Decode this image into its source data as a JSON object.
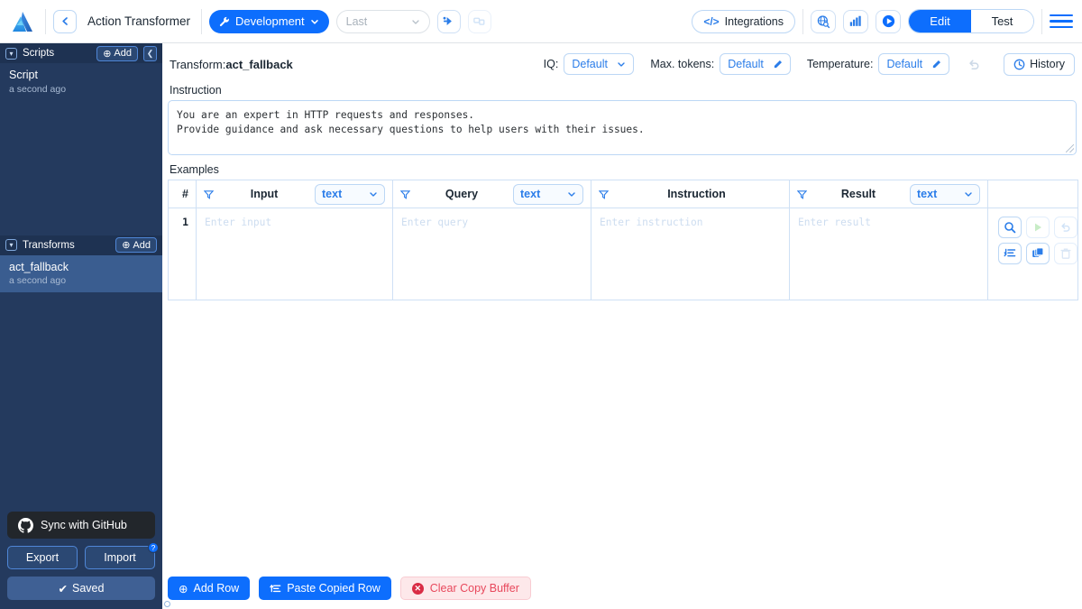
{
  "topbar": {
    "logo_icon": "action-transformer-logo",
    "back_icon": "chevron-left-icon",
    "app_title": "Action Transformer",
    "env_button": {
      "label": "Development",
      "icon": "wrench-icon",
      "caret": "chevron-down-icon"
    },
    "version_select": {
      "placeholder": "Last",
      "caret": "chevron-down-icon"
    },
    "run_icon": "run-arrow-icon",
    "duplicate_icon": "duplicate-icon",
    "integrations_button": {
      "label": "Integrations",
      "icon": "code-brackets-icon"
    },
    "globe_icon": "globe-search-icon",
    "chart_icon": "bar-chart-icon",
    "play_icon": "play-circle-icon",
    "mode_tabs": [
      {
        "label": "Edit",
        "active": true
      },
      {
        "label": "Test",
        "active": false
      }
    ],
    "menu_icon": "hamburger-menu-icon"
  },
  "sidebar": {
    "scripts": {
      "title": "Scripts",
      "add_label": "Add",
      "collapse_icon": "collapse-sidebar-icon",
      "items": [
        {
          "name": "Script",
          "time": "a second ago",
          "selected": false
        }
      ]
    },
    "transforms": {
      "title": "Transforms",
      "add_label": "Add",
      "items": [
        {
          "name": "act_fallback",
          "time": "a second ago",
          "selected": true
        }
      ]
    },
    "github_button": {
      "label": "Sync with GitHub",
      "icon": "github-icon"
    },
    "export_button": "Export",
    "import_button": "Import",
    "import_badge": "?",
    "saved_button": "Saved",
    "saved_check": "✔"
  },
  "main": {
    "transform_prefix": "Transform:",
    "transform_name": "act_fallback",
    "params": [
      {
        "label": "IQ:",
        "value": "Default",
        "control": "dropdown"
      },
      {
        "label": "Max. tokens:",
        "value": "Default",
        "control": "edit"
      },
      {
        "label": "Temperature:",
        "value": "Default",
        "control": "edit"
      }
    ],
    "undo_icon": "undo-icon",
    "history_button": {
      "label": "History",
      "icon": "clock-history-icon"
    },
    "instruction_label": "Instruction",
    "instruction_value": "You are an expert in HTTP requests and responses.\nProvide guidance and ask necessary questions to help users with their issues.",
    "examples_label": "Examples",
    "table": {
      "columns": [
        {
          "header": "#",
          "filter": false,
          "type": null
        },
        {
          "header": "Input",
          "filter": true,
          "type": "text"
        },
        {
          "header": "Query",
          "filter": true,
          "type": "text"
        },
        {
          "header": "Instruction",
          "filter": true,
          "type": null
        },
        {
          "header": "Result",
          "filter": true,
          "type": "text"
        },
        {
          "header": "",
          "filter": false,
          "type": null
        }
      ],
      "rows": [
        {
          "num": "1",
          "input_placeholder": "Enter input",
          "query_placeholder": "Enter query",
          "instruction_placeholder": "Enter instruction",
          "result_placeholder": "Enter result",
          "actions": [
            {
              "name": "inspect-row-button",
              "icon": "magnifier-icon",
              "enabled": true
            },
            {
              "name": "run-row-button",
              "icon": "play-icon",
              "enabled": false
            },
            {
              "name": "revert-row-button",
              "icon": "undo-icon",
              "enabled": false
            },
            {
              "name": "sort-row-button",
              "icon": "sort-lines-icon",
              "enabled": true
            },
            {
              "name": "copy-row-button",
              "icon": "copy-icon",
              "enabled": true
            },
            {
              "name": "delete-row-button",
              "icon": "trash-icon",
              "enabled": false
            }
          ]
        }
      ]
    },
    "footer": {
      "add_row": "Add Row",
      "paste_row": "Paste Copied Row",
      "clear_buffer": "Clear Copy Buffer"
    }
  },
  "colors": {
    "accent": "#0d6efd",
    "sidebar": "#243a5e",
    "sidebar_selected": "#3a5d90",
    "danger": "#e8485c",
    "border_blue": "#bcd7f5"
  }
}
